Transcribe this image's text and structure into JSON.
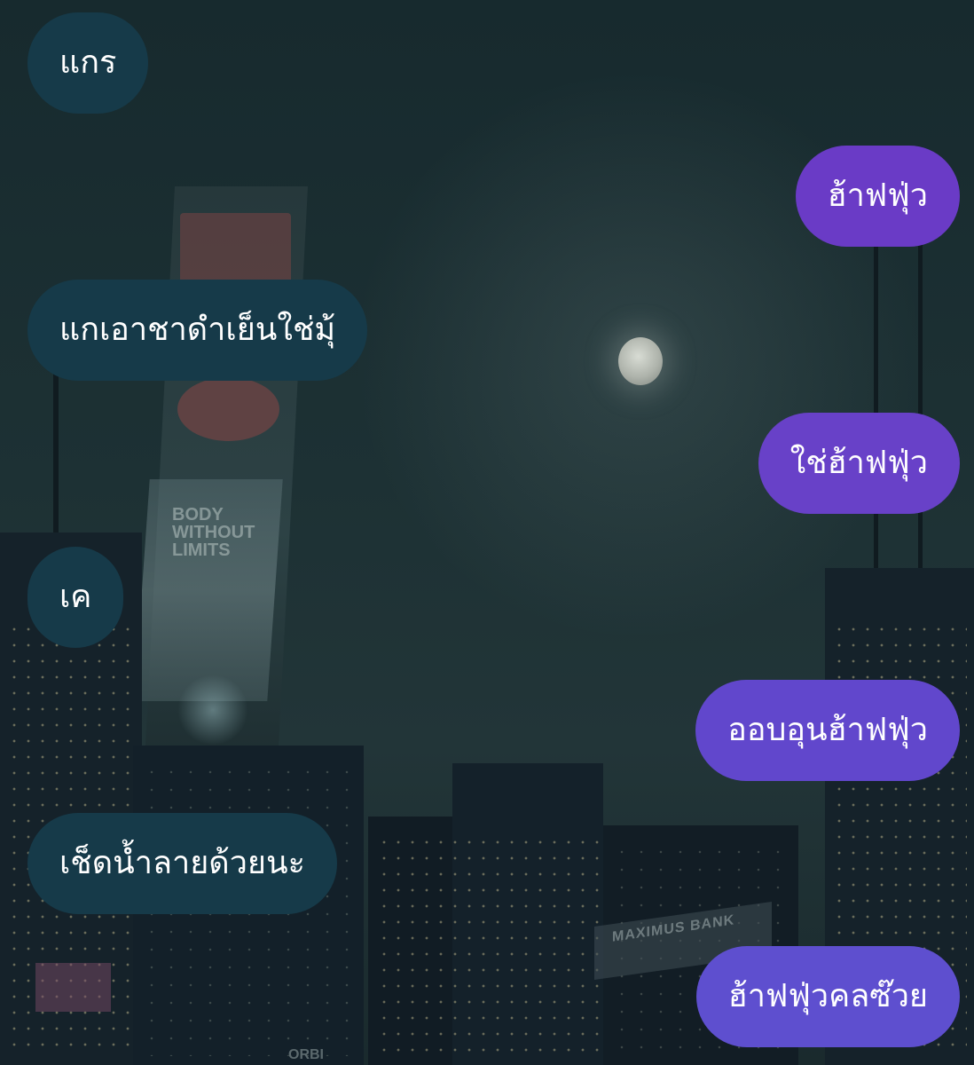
{
  "background": {
    "billboard_text": "BODY WITHOUT LIMITS",
    "sign_text": "MAXIMUS BANK",
    "bottom_text": "ORBI"
  },
  "colors": {
    "incoming_bubble": "#163a49",
    "outgoing_bubble_top": "#6a3fc4",
    "outgoing_bubble_bottom": "#5f4fcf",
    "bubble_text": "#ffffff"
  },
  "messages": [
    {
      "side": "incoming",
      "text": "แกร"
    },
    {
      "side": "outgoing",
      "text": "ฮ้าฟฟุ่ว",
      "color": "#6a3bc6"
    },
    {
      "side": "incoming",
      "text": "แกเอาชาดำเย็นใช่มุ้"
    },
    {
      "side": "outgoing",
      "text": "ใช่ฮ้าฟฟุ่ว",
      "color": "#6841c8"
    },
    {
      "side": "incoming",
      "text": "เค"
    },
    {
      "side": "outgoing",
      "text": "ออบอุนฮ้าฟฟุ่ว",
      "color": "#6147cc"
    },
    {
      "side": "incoming",
      "text": "เช็ดน้ำลายด้วยนะ"
    },
    {
      "side": "outgoing",
      "text": "ฮ้าฟฟุ่วคลซ๊วย",
      "color": "#5e4fcf"
    }
  ]
}
